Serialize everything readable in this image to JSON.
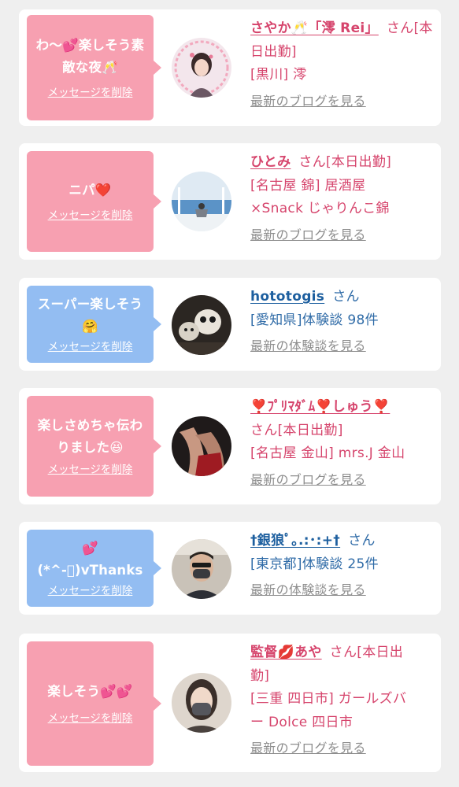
{
  "items": [
    {
      "message": "わ〜💕楽しそう素\n敵な夜🥂",
      "delete_label": "メッセージを削除",
      "name": "さやか🥂「澪 Rei」",
      "honorific": "さん[本日出勤]",
      "shop": "[黒川] 澪",
      "link_label": "最新のブログを見る",
      "avatar_icon": "user-photo-woman-heart-frame",
      "bubble_color": "#f7a0b1"
    },
    {
      "message": "ニパ❤️",
      "delete_label": "メッセージを削除",
      "name": "ひとみ",
      "honorific": "さん[本日出勤]",
      "shop": "[名古屋 錦] 居酒屋\n×Snack じゃりんこ錦",
      "link_label": "最新のブログを見る",
      "avatar_icon": "user-photo-ocean",
      "bubble_color": "#f7a0b1"
    },
    {
      "message": "スーパー楽しそう\n🤗",
      "delete_label": "メッセージを削除",
      "name": "hototogis",
      "honorific": "さん",
      "shop": "[愛知県]体験談 98件",
      "link_label": "最新の体験談を見る",
      "avatar_icon": "user-photo-plush-toys",
      "bubble_color": "#93bdf2"
    },
    {
      "message": "楽しさめちゃ伝わ\nりました😆",
      "delete_label": "メッセージを削除",
      "name": "❣️ﾌﾟﾘﾏﾀﾞﾑ❣️しゅう❣️",
      "honorific": "さん[本日出勤]",
      "shop": "[名古屋 金山] mrs.J 金山",
      "link_label": "最新のブログを見る",
      "avatar_icon": "user-photo-red-dress",
      "bubble_color": "#f7a0b1"
    },
    {
      "message": "💕\n(*^-ﾟ)vThanks",
      "delete_label": "メッセージを削除",
      "name": "†銀狼ﾟ｡.:･:+†",
      "honorific": "さん",
      "shop": "[東京都]体験談 25件",
      "link_label": "最新の体験談を見る",
      "avatar_icon": "user-photo-man-mask",
      "bubble_color": "#93bdf2"
    },
    {
      "message": "楽しそう💕💕",
      "delete_label": "メッセージを削除",
      "name": "監督💋あや",
      "honorific": "さん[本日出\n勤]",
      "shop": "[三重 四日市] ガールズバ\nー Dolce 四日市",
      "link_label": "最新のブログを見る",
      "avatar_icon": "user-photo-woman-mask",
      "bubble_color": "#f7a0b1"
    }
  ]
}
